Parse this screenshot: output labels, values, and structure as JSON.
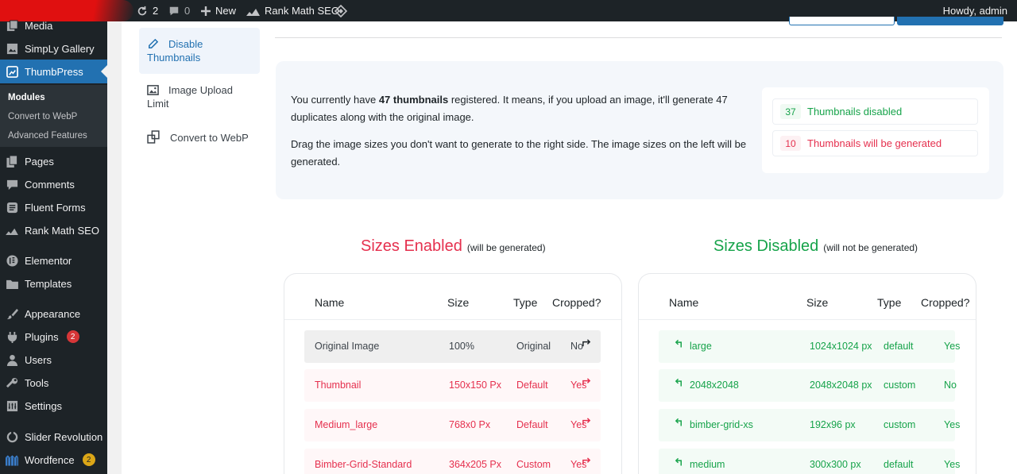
{
  "adminbar": {
    "updates_count": "2",
    "comments_count": "0",
    "new_label": "New",
    "rankmath_label": "Rank Math SEO",
    "howdy": "Howdy, admin"
  },
  "sidebar": {
    "items": [
      {
        "label": "Media",
        "icon": "media-icon"
      },
      {
        "label": "SimpLy Gallery",
        "icon": "gallery-icon"
      },
      {
        "label": "ThumbPress",
        "icon": "thumbpress-icon"
      },
      {
        "label": "Pages",
        "icon": "pages-icon"
      },
      {
        "label": "Comments",
        "icon": "comments-icon"
      },
      {
        "label": "Fluent Forms",
        "icon": "forms-icon"
      },
      {
        "label": "Rank Math SEO",
        "icon": "rankmath-icon"
      },
      {
        "label": "Elementor",
        "icon": "elementor-icon"
      },
      {
        "label": "Templates",
        "icon": "folder-icon"
      },
      {
        "label": "Appearance",
        "icon": "brush-icon"
      },
      {
        "label": "Plugins",
        "icon": "plugin-icon",
        "badge": "2"
      },
      {
        "label": "Users",
        "icon": "users-icon"
      },
      {
        "label": "Tools",
        "icon": "wrench-icon"
      },
      {
        "label": "Settings",
        "icon": "settings-icon"
      },
      {
        "label": "Slider Revolution",
        "icon": "slider-icon"
      },
      {
        "label": "Wordfence",
        "icon": "wordfence-icon",
        "badge": "2"
      }
    ],
    "submenu": [
      "Modules",
      "Convert to WebP",
      "Advanced Features"
    ]
  },
  "tabs": {
    "disable_thumbnails": "Disable Thumbnails",
    "image_upload_limit": "Image Upload Limit",
    "convert_webp": "Convert to WebP"
  },
  "info": {
    "p1_before": "You currently have ",
    "p1_bold": "47 thumbnails",
    "p1_after": " registered. It means, if you upload an image, it'll generate 47 duplicates along with the original image.",
    "p2": "Drag the image sizes you don't want to generate to the right side. The image sizes on the left will be generated.",
    "disabled_count": "37",
    "disabled_label": "Thumbnails disabled",
    "generated_count": "10",
    "generated_label": "Thumbnails will be generated"
  },
  "enabled": {
    "title": "Sizes Enabled",
    "subtitle": "(will be generated)",
    "headers": {
      "name": "Name",
      "size": "Size",
      "type": "Type",
      "cropped": "Cropped?"
    },
    "rows": [
      {
        "name": "Original Image",
        "size": "100%",
        "type": "Original",
        "cropped": "No"
      },
      {
        "name": "Thumbnail",
        "size": "150x150 Px",
        "type": "Default",
        "cropped": "Yes"
      },
      {
        "name": "Medium_large",
        "size": "768x0 Px",
        "type": "Default",
        "cropped": "Yes"
      },
      {
        "name": "Bimber-Grid-Standard",
        "size": "364x205 Px",
        "type": "Custom",
        "cropped": "Yes"
      }
    ]
  },
  "disabled": {
    "title": "Sizes Disabled",
    "subtitle": "(will not be generated)",
    "headers": {
      "name": "Name",
      "size": "Size",
      "type": "Type",
      "cropped": "Cropped?"
    },
    "rows": [
      {
        "name": "large",
        "size": "1024x1024 px",
        "type": "default",
        "cropped": "Yes"
      },
      {
        "name": "2048x2048",
        "size": "2048x2048 px",
        "type": "custom",
        "cropped": "No"
      },
      {
        "name": "bimber-grid-xs",
        "size": "192x96 px",
        "type": "custom",
        "cropped": "Yes"
      },
      {
        "name": "medium",
        "size": "300x300 px",
        "type": "default",
        "cropped": "Yes"
      }
    ]
  },
  "colors": {
    "accent": "#2271b1",
    "enabled": "#e5304e",
    "disabled": "#16a34a",
    "sidebar": "#1d2327"
  }
}
